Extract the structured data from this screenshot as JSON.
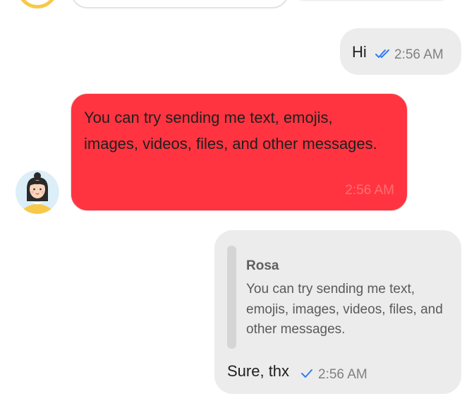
{
  "messages": {
    "hi": {
      "text": "Hi",
      "time": "2:56 AM",
      "status_icon": "double-check-icon"
    },
    "incoming": {
      "text": "You can try sending me text, emojis, images, videos, files, and other messages.",
      "time": "2:56 AM",
      "bubble_color": "#ff3440"
    },
    "reply": {
      "quoted_name": "Rosa",
      "quoted_text": "You can try sending me text, emojis, images, videos, files, and other messages.",
      "text": "Sure, thx",
      "time": "2:56 AM",
      "status_icon": "single-check-icon"
    }
  },
  "colors": {
    "outgoing_bubble": "#ececec",
    "check_blue": "#2f7df6",
    "avatar_ring": "#f7c948"
  }
}
